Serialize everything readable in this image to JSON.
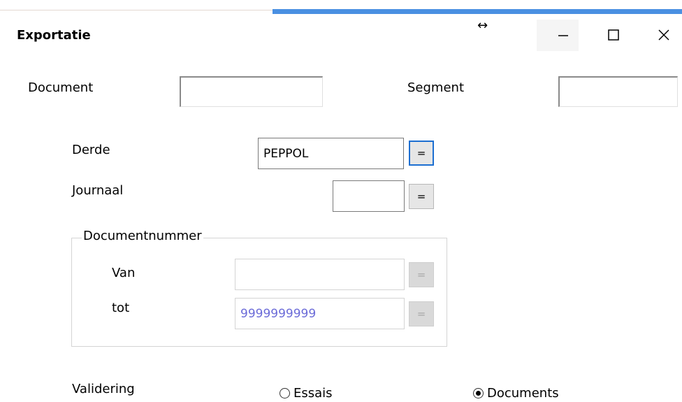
{
  "window": {
    "title": "Exportatie",
    "drag_glyph": "↔",
    "minimize_icon": "minimize-icon",
    "maximize_icon": "maximize-icon",
    "close_icon": "close-icon"
  },
  "form": {
    "document_label": "Document",
    "document_value": "",
    "segment_label": "Segment",
    "segment_value": "",
    "derde_label": "Derde",
    "derde_value": "PEPPOL",
    "journaal_label": "Journaal",
    "journaal_value": "",
    "lookup_button_label": "=",
    "documentnummer": {
      "legend": "Documentnummer",
      "van_label": "Van",
      "van_value": "",
      "tot_label": "tot",
      "tot_value": "9999999999"
    },
    "validering_label": "Validering",
    "options": {
      "essais_label": "Essais",
      "essais_selected": false,
      "documents_label": "Documents",
      "documents_selected": true
    }
  },
  "colors": {
    "accent": "#4a90e2",
    "focus_border": "#1d6fd1",
    "disabled_text": "#6b6bd8"
  }
}
